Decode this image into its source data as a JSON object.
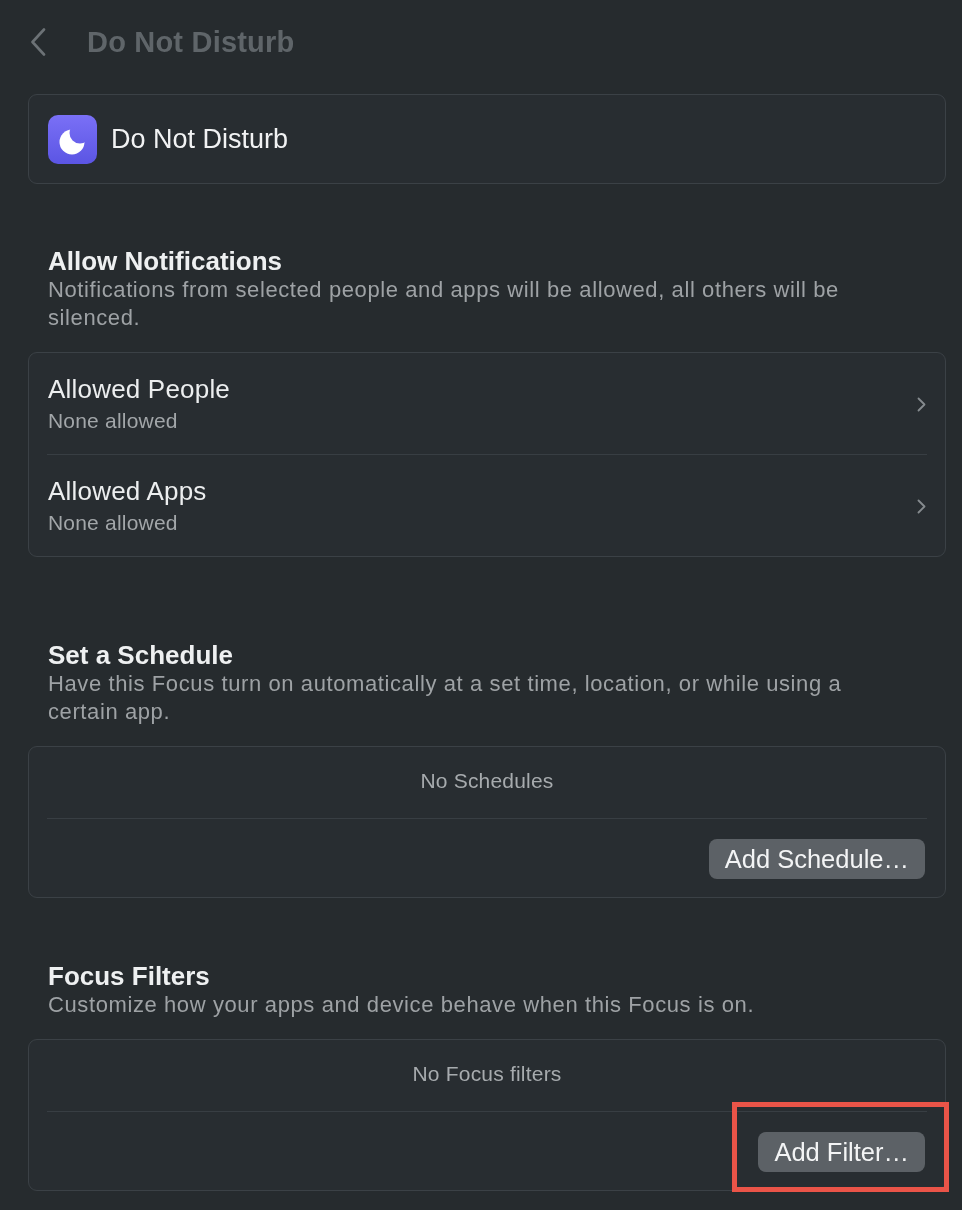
{
  "header": {
    "title": "Do Not Disturb"
  },
  "focus_card": {
    "name": "Do Not Disturb"
  },
  "sections": [
    {
      "kind": "list",
      "heading": "Allow Notifications",
      "description": "Notifications from selected people and apps will be allowed, all others will be silenced.",
      "rows": [
        {
          "title": "Allowed People",
          "subtitle": "None allowed"
        },
        {
          "title": "Allowed Apps",
          "subtitle": "None allowed"
        }
      ]
    },
    {
      "kind": "empty",
      "heading": "Set a Schedule",
      "description": "Have this Focus turn on automatically at a set time, location, or while using a certain app.",
      "empty_text": "No Schedules",
      "button": {
        "label": "Add Schedule…",
        "highlighted": false
      }
    },
    {
      "kind": "empty",
      "heading": "Focus Filters",
      "description": "Customize how your apps and device behave when this Focus is on.",
      "empty_text": "No Focus filters",
      "button": {
        "label": "Add Filter…",
        "highlighted": true
      }
    }
  ]
}
